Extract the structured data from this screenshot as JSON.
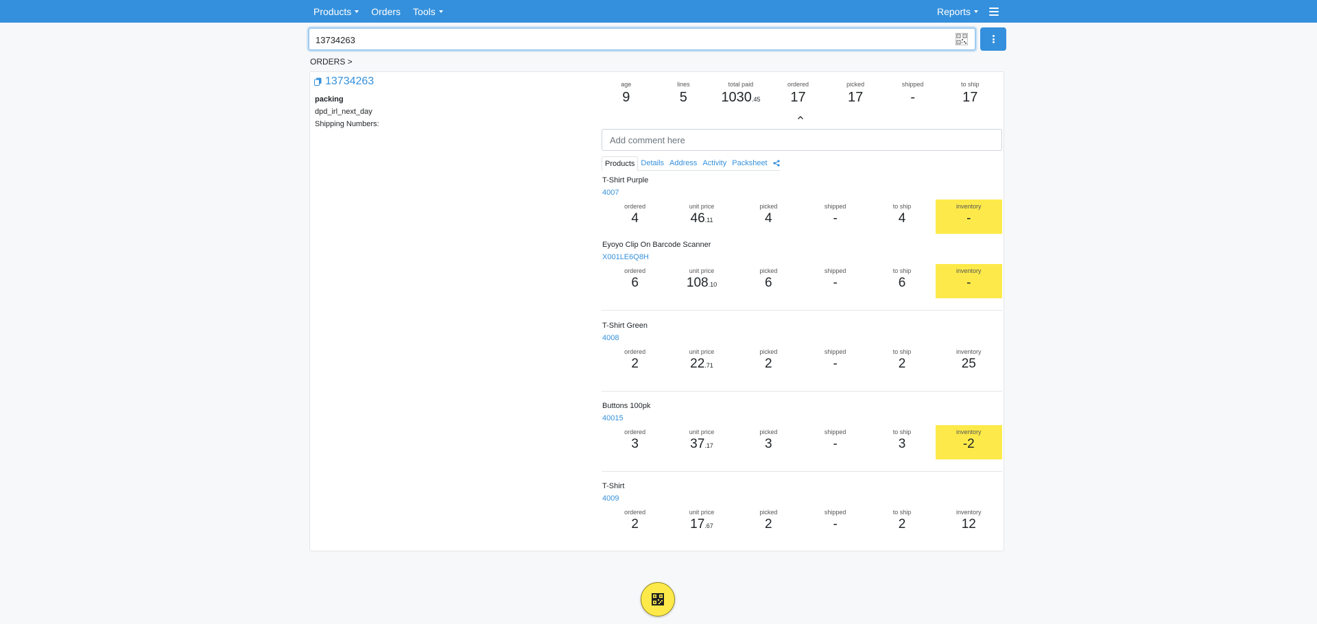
{
  "nav": {
    "products": "Products",
    "orders": "Orders",
    "tools": "Tools",
    "reports": "Reports"
  },
  "search": {
    "value": "13734263"
  },
  "breadcrumb": "ORDERS >",
  "order": {
    "number": "13734263",
    "status": "packing",
    "courier": "dpd_irl_next_day",
    "shipping_numbers_label": "Shipping Numbers:"
  },
  "summary": [
    {
      "label": "age",
      "value": "9",
      "cents": ""
    },
    {
      "label": "lines",
      "value": "5",
      "cents": ""
    },
    {
      "label": "total paid",
      "value": "1030",
      "cents": ".45"
    },
    {
      "label": "ordered",
      "value": "17",
      "cents": ""
    },
    {
      "label": "picked",
      "value": "17",
      "cents": ""
    },
    {
      "label": "shipped",
      "value": "-",
      "cents": ""
    },
    {
      "label": "to ship",
      "value": "17",
      "cents": ""
    }
  ],
  "comment": {
    "placeholder": "Add comment here"
  },
  "tabs": [
    "Products",
    "Details",
    "Address",
    "Activity",
    "Packsheet"
  ],
  "stat_labels": {
    "ordered": "ordered",
    "unit_price": "unit price",
    "picked": "picked",
    "shipped": "shipped",
    "to_ship": "to ship",
    "inventory": "inventory"
  },
  "products": [
    {
      "name": "T-Shirt Purple",
      "sku": "4007",
      "ordered": "4",
      "price": "46",
      "cents": ".11",
      "picked": "4",
      "shipped": "-",
      "to_ship": "4",
      "inventory": "-",
      "highlight": true
    },
    {
      "name": "Eyoyo Clip On Barcode Scanner",
      "sku": "X001LE6Q8H",
      "ordered": "6",
      "price": "108",
      "cents": ".10",
      "picked": "6",
      "shipped": "-",
      "to_ship": "6",
      "inventory": "-",
      "highlight": true
    },
    {
      "name": "T-Shirt Green",
      "sku": "4008",
      "ordered": "2",
      "price": "22",
      "cents": ".71",
      "picked": "2",
      "shipped": "-",
      "to_ship": "2",
      "inventory": "25",
      "highlight": false
    },
    {
      "name": "Buttons 100pk",
      "sku": "40015",
      "ordered": "3",
      "price": "37",
      "cents": ".17",
      "picked": "3",
      "shipped": "-",
      "to_ship": "3",
      "inventory": "-2",
      "highlight": true
    },
    {
      "name": "T-Shirt",
      "sku": "4009",
      "ordered": "2",
      "price": "17",
      "cents": ".67",
      "picked": "2",
      "shipped": "-",
      "to_ship": "2",
      "inventory": "12",
      "highlight": false
    }
  ],
  "colors": {
    "primary": "#3490dc",
    "highlight": "#fdea4a"
  },
  "icons": {
    "menu": "hamburger-icon",
    "scan": "qr-code-icon",
    "copy": "copy-icon",
    "share": "share-icon",
    "more": "kebab-icon"
  }
}
